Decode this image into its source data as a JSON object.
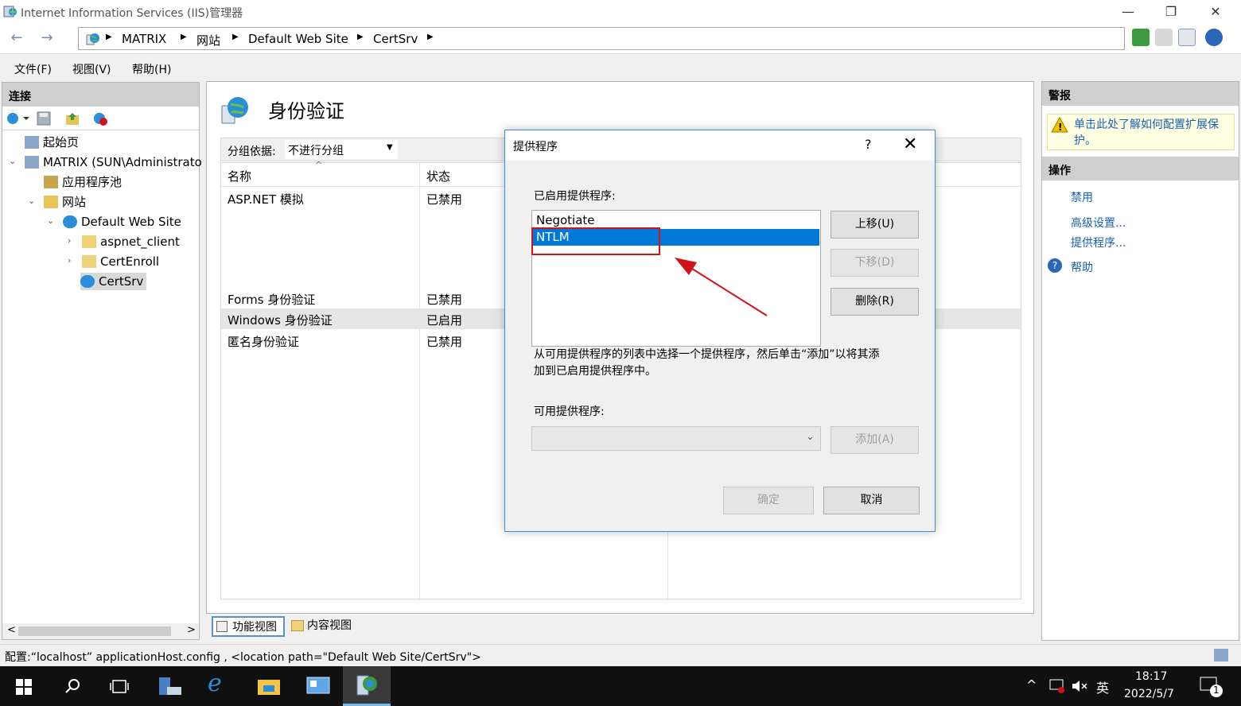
{
  "window": {
    "title": "Internet Information Services (IIS)管理器",
    "minimize": "—",
    "restore": "❐",
    "close": "✕"
  },
  "address": {
    "back": "←",
    "forward": "→",
    "crumbs": [
      "MATRIX",
      "网站",
      "Default Web Site",
      "CertSrv"
    ],
    "sep": "▶"
  },
  "menu": {
    "file": "文件(F)",
    "view": "视图(V)",
    "help": "帮助(H)"
  },
  "left": {
    "header": "连接",
    "tree": [
      {
        "label": "起始页"
      },
      {
        "label": "MATRIX (SUN\\Administrato"
      },
      {
        "label": "应用程序池"
      },
      {
        "label": "网站"
      },
      {
        "label": "Default Web Site"
      },
      {
        "label": "aspnet_client"
      },
      {
        "label": "CertEnroll"
      },
      {
        "label": "CertSrv"
      }
    ],
    "scroll_left": "<",
    "scroll_right": ">"
  },
  "center": {
    "title": "身份验证",
    "group_label": "分组依据:",
    "group_value": "不进行分组",
    "columns": {
      "name": "名称",
      "status": "状态"
    },
    "rows": [
      {
        "name": "ASP.NET 模拟",
        "status": "已禁用"
      },
      {
        "name": "Forms 身份验证",
        "status": "已禁用"
      },
      {
        "name": "Windows 身份验证",
        "status": "已启用"
      },
      {
        "name": "匿名身份验证",
        "status": "已禁用"
      }
    ],
    "tabs": {
      "features": "功能视图",
      "content": "内容视图"
    }
  },
  "right": {
    "alert_header": "警报",
    "alert_text": "单击此处了解如何配置扩展保护。",
    "actions_header": "操作",
    "actions": {
      "disable": "禁用",
      "advanced": "高级设置...",
      "providers": "提供程序...",
      "help": "帮助"
    }
  },
  "status": {
    "text": "配置:“localhost” applicationHost.config , <location path=\"Default Web Site/CertSrv\">"
  },
  "dialog": {
    "title": "提供程序",
    "help": "?",
    "close": "✕",
    "enabled_label": "已启用提供程序:",
    "enabled_items": [
      "Negotiate",
      "NTLM"
    ],
    "move_up": "上移(U)",
    "move_down": "下移(D)",
    "remove": "删除(R)",
    "description": "从可用提供程序的列表中选择一个提供程序，然后单击“添加”以将其添加到已启用提供程序中。",
    "available_label": "可用提供程序:",
    "available_value": "",
    "add": "添加(A)",
    "ok": "确定",
    "cancel": "取消"
  },
  "taskbar": {
    "ime": "英",
    "time": "18:17",
    "date": "2022/5/7",
    "notif_count": "1"
  },
  "colors": {
    "accent": "#0078d7",
    "link": "#1a5fb4",
    "highlight": "#d0121b"
  }
}
